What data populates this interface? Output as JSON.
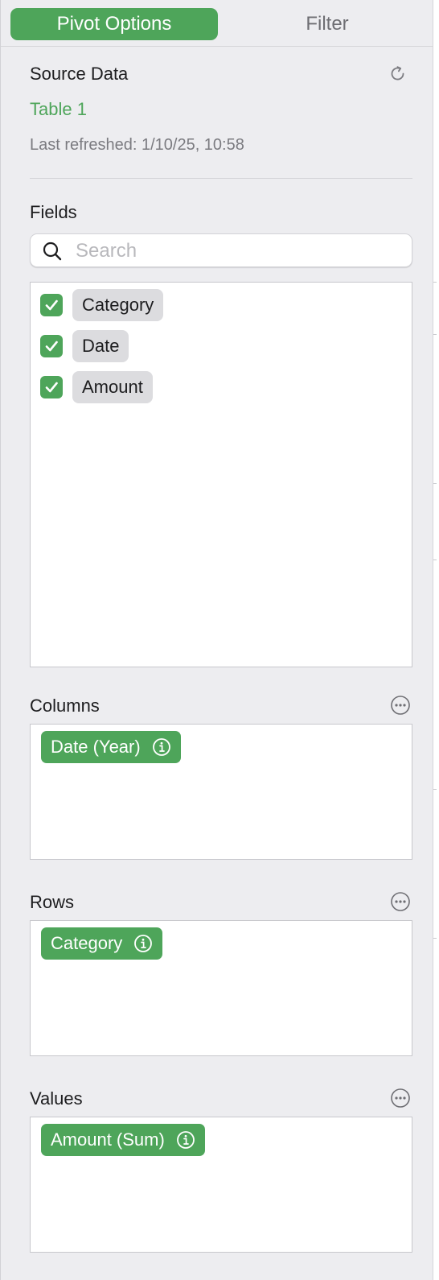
{
  "tabs": {
    "pivot_options": "Pivot Options",
    "filter": "Filter"
  },
  "source": {
    "heading": "Source Data",
    "table_name": "Table 1",
    "last_refreshed": "Last refreshed: 1/10/25, 10:58",
    "refresh_icon": "refresh-icon"
  },
  "fields": {
    "heading": "Fields",
    "search_placeholder": "Search",
    "items": [
      {
        "label": "Category",
        "checked": true
      },
      {
        "label": "Date",
        "checked": true
      },
      {
        "label": "Amount",
        "checked": true
      }
    ]
  },
  "columns": {
    "heading": "Columns",
    "pill": "Date (Year)"
  },
  "rows": {
    "heading": "Rows",
    "pill": "Category"
  },
  "values": {
    "heading": "Values",
    "pill": "Amount (Sum)"
  },
  "colors": {
    "accent": "#4ea55a",
    "panel_bg": "#ededf0"
  }
}
